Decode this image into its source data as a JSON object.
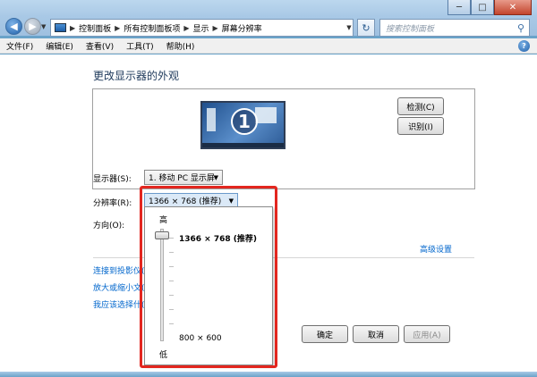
{
  "window": {
    "minimize": "─",
    "maximize": "□",
    "close": "✕"
  },
  "nav": {
    "back": "◀",
    "forward": "▶",
    "refresh": "↻"
  },
  "address": {
    "crumbs": [
      "控制面板",
      "所有控制面板项",
      "显示",
      "屏幕分辨率"
    ]
  },
  "search": {
    "placeholder": "搜索控制面板"
  },
  "menu": {
    "file": "文件(F)",
    "edit": "编辑(E)",
    "view": "查看(V)",
    "tools": "工具(T)",
    "help": "帮助(H)"
  },
  "page": {
    "title": "更改显示器的外观"
  },
  "preview": {
    "monitor_number": "1",
    "detect": "检测(C)",
    "identify": "识别(I)"
  },
  "display": {
    "label": "显示器(S):",
    "value": "1. 移动 PC 显示屏"
  },
  "resolution": {
    "label": "分辨率(R):",
    "value": "1366 × 768 (推荐)"
  },
  "orientation": {
    "label": "方向(O):"
  },
  "advanced": "高级设置",
  "links": [
    "连接到投影仪(",
    "放大或缩小文(",
    "我应该选择什("
  ],
  "buttons": {
    "ok": "确定",
    "cancel": "取消",
    "apply": "应用(A)"
  },
  "popup": {
    "high": "高",
    "low": "低",
    "top_res": "1366 × 768 (推荐)",
    "bottom_res": "800 × 600",
    "slider_level": 1.0
  },
  "colors": {
    "highlight_box": "#e3261f",
    "link": "#0066cc"
  }
}
